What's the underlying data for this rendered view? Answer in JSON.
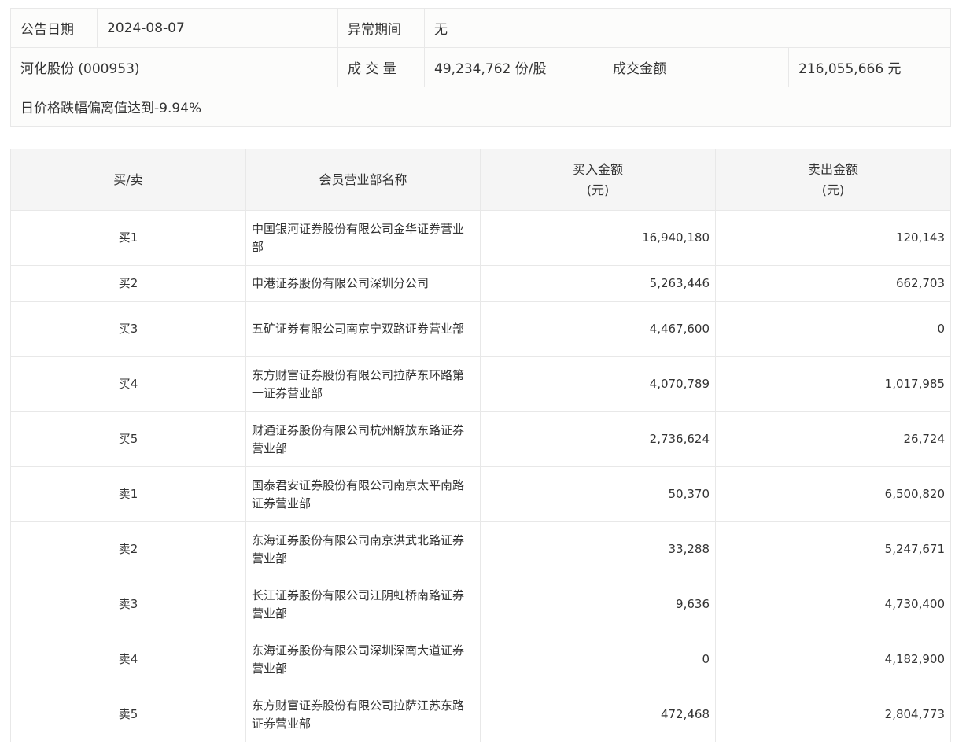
{
  "info": {
    "date_label": "公告日期",
    "date": "2024-08-07",
    "period_label": "异常期间",
    "period": "无",
    "stock": "河化股份 (000953)",
    "volume_label": "成 交 量",
    "volume": "49,234,762 份/股",
    "amount_label": "成交金额",
    "amount": "216,055,666 元",
    "reason": "日价格跌幅偏离值达到-9.94%"
  },
  "table": {
    "headers": [
      "买/卖",
      "会员营业部名称",
      "买入金额\n(元)",
      "卖出金额\n(元)"
    ],
    "header_lines": {
      "buy": [
        "买入金额",
        "(元)"
      ],
      "sell": [
        "卖出金额",
        "(元)"
      ]
    },
    "rows": [
      {
        "side": "买1",
        "name": "中国银河证券股份有限公司金华证券营业部",
        "buy": "16,940,180",
        "sell": "120,143"
      },
      {
        "side": "买2",
        "name": "申港证券股份有限公司深圳分公司",
        "buy": "5,263,446",
        "sell": "662,703"
      },
      {
        "side": "买3",
        "name": "五矿证券有限公司南京宁双路证券营业部",
        "buy": "4,467,600",
        "sell": "0"
      },
      {
        "side": "买4",
        "name": "东方财富证券股份有限公司拉萨东环路第一证券营业部",
        "buy": "4,070,789",
        "sell": "1,017,985"
      },
      {
        "side": "买5",
        "name": "财通证券股份有限公司杭州解放东路证券营业部",
        "buy": "2,736,624",
        "sell": "26,724"
      },
      {
        "side": "卖1",
        "name": "国泰君安证券股份有限公司南京太平南路证券营业部",
        "buy": "50,370",
        "sell": "6,500,820"
      },
      {
        "side": "卖2",
        "name": "东海证券股份有限公司南京洪武北路证券营业部",
        "buy": "33,288",
        "sell": "5,247,671"
      },
      {
        "side": "卖3",
        "name": "长江证券股份有限公司江阴虹桥南路证券营业部",
        "buy": "9,636",
        "sell": "4,730,400"
      },
      {
        "side": "卖4",
        "name": "东海证券股份有限公司深圳深南大道证券营业部",
        "buy": "0",
        "sell": "4,182,900"
      },
      {
        "side": "卖5",
        "name": "东方财富证券股份有限公司拉萨江苏东路证券营业部",
        "buy": "472,468",
        "sell": "2,804,773"
      }
    ]
  }
}
